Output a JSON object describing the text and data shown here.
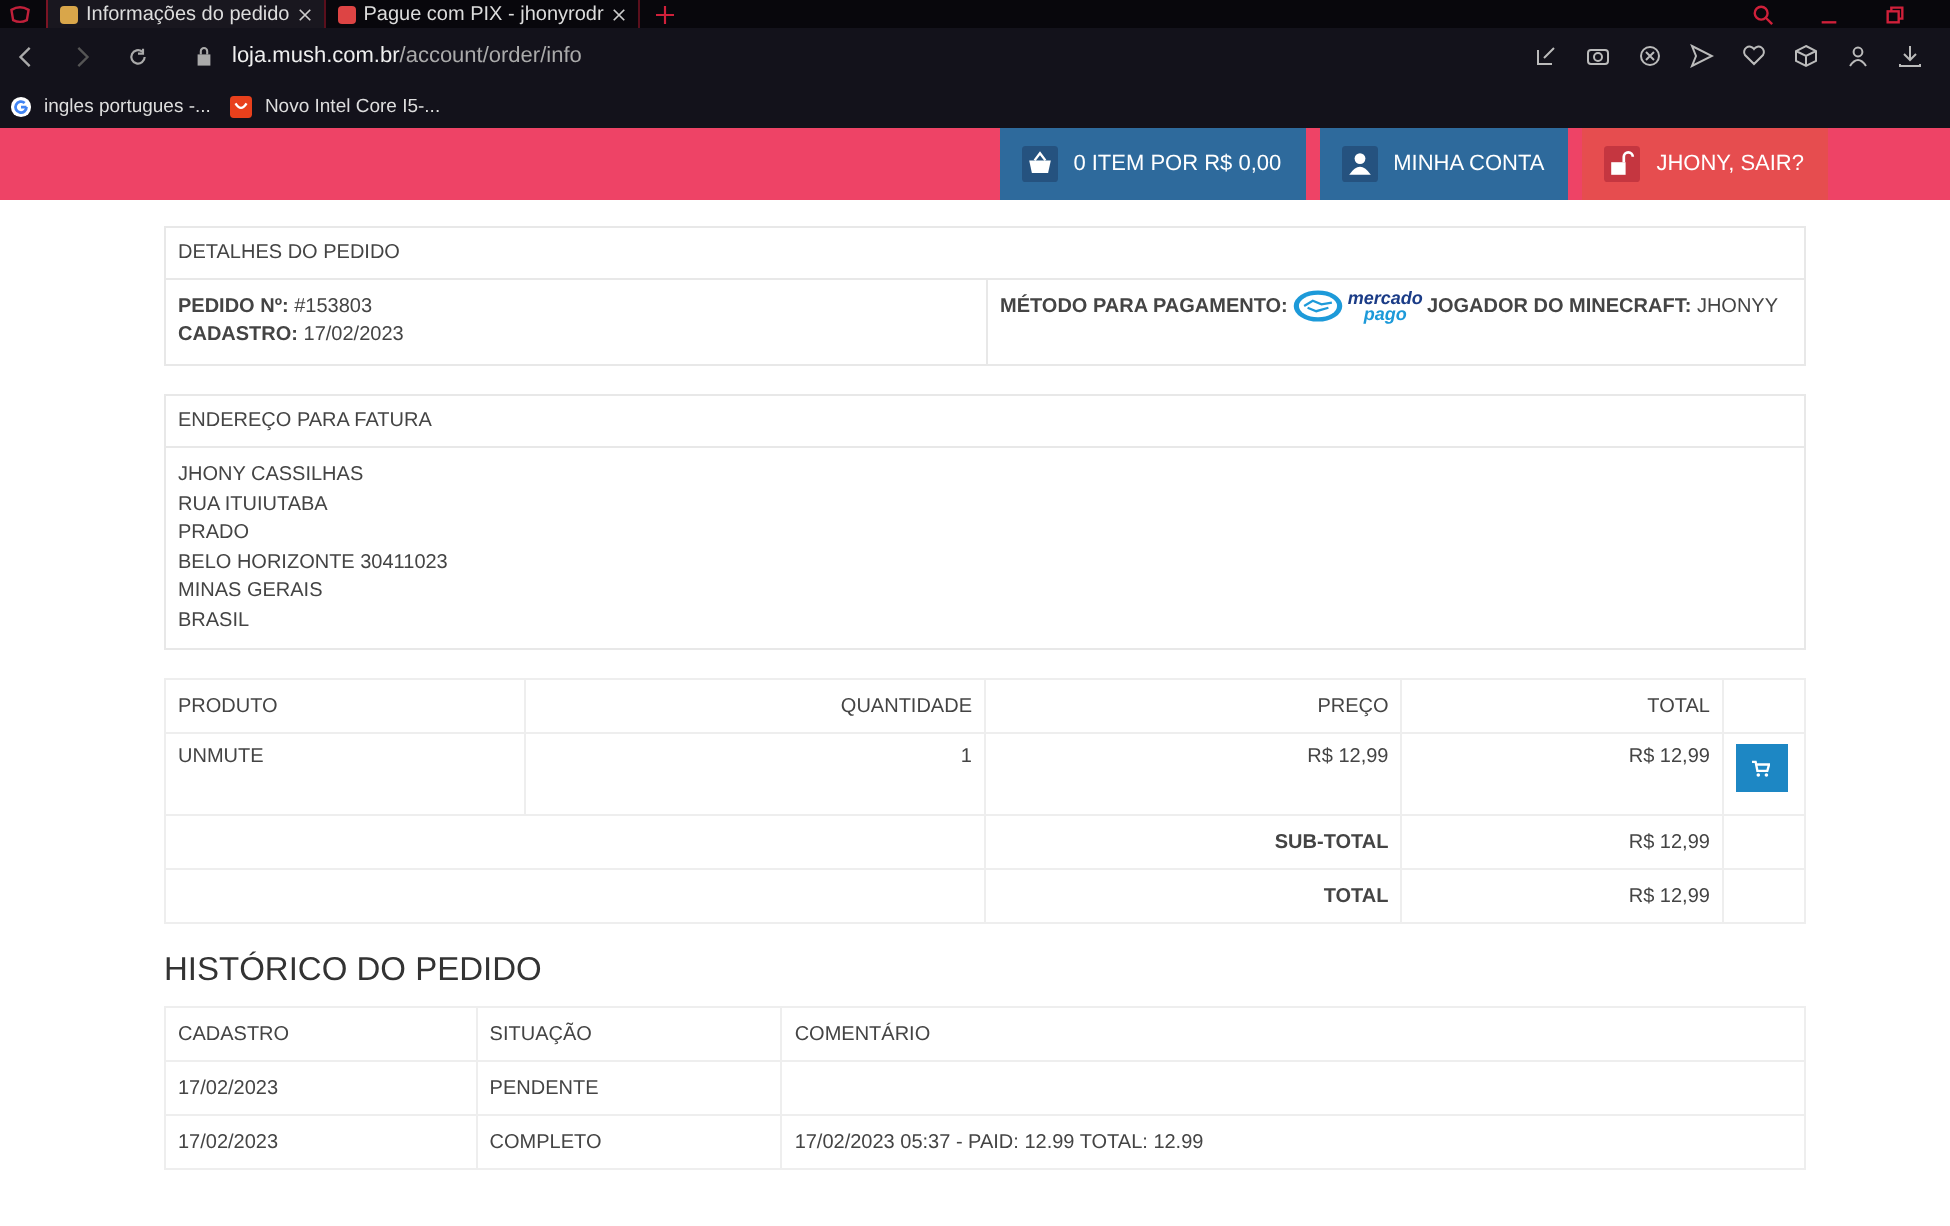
{
  "browser": {
    "tabs": [
      {
        "title": "Informações do pedido",
        "selected": true
      },
      {
        "title": "Pague com PIX - jhonyrodr",
        "selected": false
      }
    ],
    "url_host": "loja.mush.com.br",
    "url_path": "/account/order/info",
    "bookmarks": [
      "ingles portugues -...",
      "Novo Intel Core I5-..."
    ]
  },
  "header": {
    "buttons": [
      {
        "label": "0 ITEM POR R$ 0,00",
        "kind": "cart"
      },
      {
        "label": "MINHA CONTA",
        "kind": "account"
      },
      {
        "label": "JHONY, SAIR?",
        "kind": "logout"
      }
    ]
  },
  "details": {
    "heading": "DETALHES DO PEDIDO",
    "order_label": "PEDIDO Nº:",
    "order_value": "#153803",
    "date_label": "CADASTRO:",
    "date_value": "17/02/2023",
    "payment_label": "MÉTODO PARA PAGAMENTO:",
    "payment_logo": [
      "mercado",
      "pago"
    ],
    "player_label": "JOGADOR DO MINECRAFT:",
    "player_value": "JHONYY"
  },
  "billing": {
    "heading": "ENDEREÇO PARA FATURA",
    "lines": [
      "JHONY CASSILHAS",
      "RUA ITUIUTABA",
      "PRADO",
      "BELO HORIZONTE 30411023",
      "MINAS GERAIS",
      "BRASIL"
    ]
  },
  "products": {
    "columns": [
      "PRODUTO",
      "QUANTIDADE",
      "PREÇO",
      "TOTAL"
    ],
    "rows": [
      [
        "UNMUTE",
        "1",
        "R$ 12,99",
        "R$ 12,99"
      ]
    ],
    "totals": [
      {
        "label": "SUB-TOTAL",
        "value": "R$ 12,99"
      },
      {
        "label": "TOTAL",
        "value": "R$ 12,99"
      }
    ]
  },
  "history": {
    "title": "HISTÓRICO DO PEDIDO",
    "columns": [
      "CADASTRO",
      "SITUAÇÃO",
      "COMENTÁRIO"
    ],
    "rows": [
      [
        "17/02/2023",
        "PENDENTE",
        ""
      ],
      [
        "17/02/2023",
        "COMPLETO",
        "17/02/2023 05:37 - PAID: 12.99 TOTAL: 12.99"
      ]
    ]
  }
}
